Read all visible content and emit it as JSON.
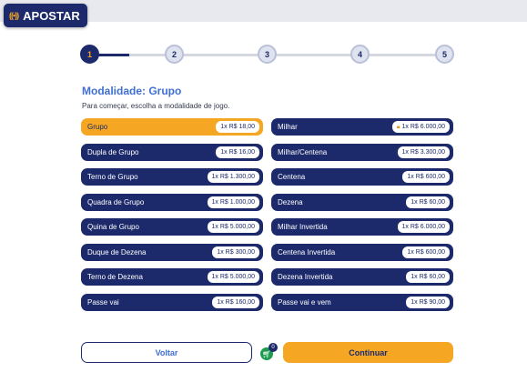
{
  "header": {
    "apostar_label": "APOSTAR",
    "apostar_icon": "broadcast-icon"
  },
  "stepper": {
    "steps": [
      "1",
      "2",
      "3",
      "4",
      "5"
    ],
    "active_step": 1
  },
  "main": {
    "title": "Modalidade: Grupo",
    "subtitle": "Para começar, escolha a modalidade de jogo."
  },
  "options_left": [
    {
      "label": "Grupo",
      "price": "1x R$ 18,00",
      "selected": true
    },
    {
      "label": "Dupla de Grupo",
      "price": "1x R$ 16,00"
    },
    {
      "label": "Terno de Grupo",
      "price": "1x R$ 1.300,00"
    },
    {
      "label": "Quadra de Grupo",
      "price": "1x R$ 1.000,00"
    },
    {
      "label": "Quina de Grupo",
      "price": "1x R$ 5.000,00"
    },
    {
      "label": "Duque de Dezena",
      "price": "1x R$ 300,00"
    },
    {
      "label": "Terno de Dezena",
      "price": "1x R$ 5.000,00"
    },
    {
      "label": "Passe vai",
      "price": "1x R$ 160,00"
    }
  ],
  "options_right": [
    {
      "label": "Milhar",
      "price": "1x R$ 6.000,00",
      "icon": "lock-icon"
    },
    {
      "label": "Milhar/Centena",
      "price": "1x R$ 3.300,00"
    },
    {
      "label": "Centena",
      "price": "1x R$ 600,00"
    },
    {
      "label": "Dezena",
      "price": "1x R$ 60,00"
    },
    {
      "label": "Milhar Invertida",
      "price": "1x R$ 6.000,00"
    },
    {
      "label": "Centena Invertida",
      "price": "1x R$ 600,00"
    },
    {
      "label": "Dezena Invertida",
      "price": "1x R$ 60,00"
    },
    {
      "label": "Passe vai e vem",
      "price": "1x R$ 90,00"
    }
  ],
  "footer": {
    "back_label": "Voltar",
    "next_label": "Continuar",
    "cart_count": "0",
    "cart_icon": "cart-icon"
  },
  "colors": {
    "primary": "#1c2a6b",
    "accent": "#f5a623",
    "title": "#3f6fd3",
    "cart": "#1d9b4f"
  }
}
